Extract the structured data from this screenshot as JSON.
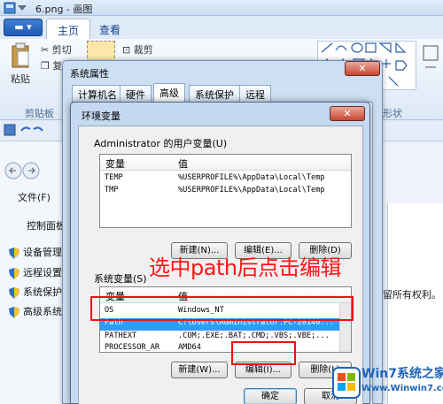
{
  "paint": {
    "window_title": "6.png - 画图",
    "tabs": [
      "主页",
      "查看"
    ],
    "ribbon": {
      "paste_label": "粘贴",
      "cut_label": "剪切",
      "copy_label": "复制",
      "crop_label": "裁剪",
      "clipboard_group": "剪贴板",
      "shapes_group": "形状"
    },
    "file_menu": "文件(F)",
    "control_panel": "控制面板",
    "side_items": [
      "设备管理",
      "远程设置",
      "系统保护",
      "高级系统"
    ],
    "right_text": "留所有权利。"
  },
  "system_properties": {
    "title": "系统属性",
    "close_label": "✕",
    "tabs": [
      "计算机名",
      "硬件",
      "高级",
      "系统保护",
      "远程"
    ],
    "active_tab": "高级"
  },
  "env_dialog": {
    "title": "环境变量",
    "close_label": "✕",
    "user_section_label": "Administrator 的用户变量(U)",
    "user_columns": [
      "变量",
      "值"
    ],
    "user_rows": [
      {
        "name": "TEMP",
        "value": "%USERPROFILE%\\AppData\\Local\\Temp"
      },
      {
        "name": "TMP",
        "value": "%USERPROFILE%\\AppData\\Local\\Temp"
      }
    ],
    "user_buttons": {
      "new": "新建(N)...",
      "edit": "编辑(E)...",
      "delete": "删除(D)"
    },
    "system_section_label": "系统变量(S)",
    "system_columns": [
      "变量",
      "值"
    ],
    "system_rows": [
      {
        "name": "OS",
        "value": "Windows_NT"
      },
      {
        "name": "Path",
        "value": "C:\\Users\\Administrator.PC-20140...",
        "selected": true
      },
      {
        "name": "PATHEXT",
        "value": ".COM;.EXE;.BAT;.CMD;.VBS;.VBE;..."
      },
      {
        "name": "PROCESSOR_AR",
        "value": "AMD64"
      }
    ],
    "system_buttons": {
      "new": "新建(W)...",
      "edit": "编辑(I)...",
      "delete": "删除(L)"
    },
    "ok_label": "确定",
    "cancel_label": "取消"
  },
  "annotation": {
    "text": "选中path后点击编辑",
    "color": "#ff1515"
  },
  "watermark": {
    "brand": "Win7系统之家",
    "url": "Www.Winwin7.com"
  }
}
